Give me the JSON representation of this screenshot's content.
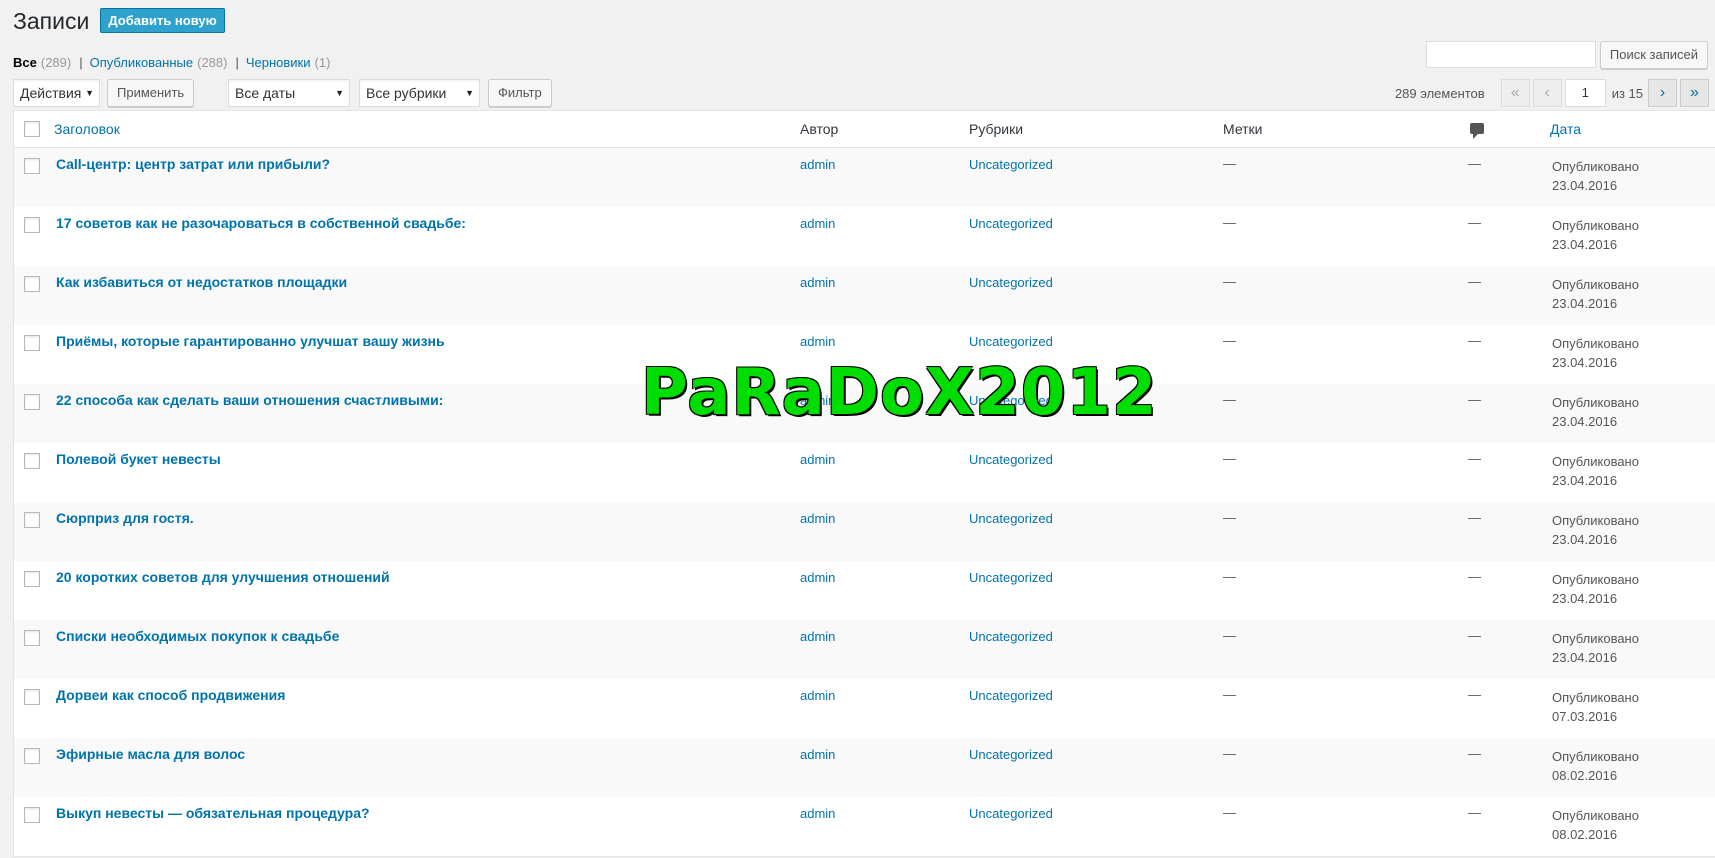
{
  "header": {
    "title": "Записи",
    "add_new": "Добавить новую"
  },
  "filters": {
    "all_label": "Все",
    "all_count": "(289)",
    "published_label": "Опубликованные",
    "published_count": "(288)",
    "drafts_label": "Черновики",
    "drafts_count": "(1)",
    "separator": "|"
  },
  "search": {
    "button": "Поиск записей",
    "value": ""
  },
  "toolbar": {
    "bulk_actions": "Действия",
    "apply": "Применить",
    "dates": "Все даты",
    "categories": "Все рубрики",
    "filter": "Фильтр"
  },
  "pagination": {
    "total": "289 элементов",
    "first": "«",
    "prev": "‹",
    "current": "1",
    "of": "из 15",
    "next": "›",
    "last": "»"
  },
  "table": {
    "columns": {
      "title": "Заголовок",
      "author": "Автор",
      "categories": "Рубрики",
      "tags": "Метки",
      "comments_icon": "comment-icon",
      "date": "Дата"
    },
    "rows": [
      {
        "title": "Call-центр: центр затрат или прибыли?",
        "author": "admin",
        "category": "Uncategorized",
        "tags": "—",
        "comments": "—",
        "status": "Опубликовано",
        "date": "23.04.2016"
      },
      {
        "title": "17 советов как не разочароваться в собственной свадьбе:",
        "author": "admin",
        "category": "Uncategorized",
        "tags": "—",
        "comments": "—",
        "status": "Опубликовано",
        "date": "23.04.2016"
      },
      {
        "title": "Как избавиться от недостатков площадки",
        "author": "admin",
        "category": "Uncategorized",
        "tags": "—",
        "comments": "—",
        "status": "Опубликовано",
        "date": "23.04.2016"
      },
      {
        "title": "Приёмы, которые гарантированно улучшат вашу жизнь",
        "author": "admin",
        "category": "Uncategorized",
        "tags": "—",
        "comments": "—",
        "status": "Опубликовано",
        "date": "23.04.2016"
      },
      {
        "title": "22 способа как сделать ваши отношения счастливыми:",
        "author": "admin",
        "category": "Uncategorized",
        "tags": "—",
        "comments": "—",
        "status": "Опубликовано",
        "date": "23.04.2016"
      },
      {
        "title": "Полевой букет невесты",
        "author": "admin",
        "category": "Uncategorized",
        "tags": "—",
        "comments": "—",
        "status": "Опубликовано",
        "date": "23.04.2016"
      },
      {
        "title": "Сюрприз для гостя.",
        "author": "admin",
        "category": "Uncategorized",
        "tags": "—",
        "comments": "—",
        "status": "Опубликовано",
        "date": "23.04.2016"
      },
      {
        "title": "20 коротких советов для улучшения отношений",
        "author": "admin",
        "category": "Uncategorized",
        "tags": "—",
        "comments": "—",
        "status": "Опубликовано",
        "date": "23.04.2016"
      },
      {
        "title": "Списки необходимых покупок к свадьбе",
        "author": "admin",
        "category": "Uncategorized",
        "tags": "—",
        "comments": "—",
        "status": "Опубликовано",
        "date": "23.04.2016"
      },
      {
        "title": "Дорвеи как способ продвижения",
        "author": "admin",
        "category": "Uncategorized",
        "tags": "—",
        "comments": "—",
        "status": "Опубликовано",
        "date": "07.03.2016"
      },
      {
        "title": "Эфирные масла для волос",
        "author": "admin",
        "category": "Uncategorized",
        "tags": "—",
        "comments": "—",
        "status": "Опубликовано",
        "date": "08.02.2016"
      },
      {
        "title": "Выкуп невесты — обязательная процедура?",
        "author": "admin",
        "category": "Uncategorized",
        "tags": "—",
        "comments": "—",
        "status": "Опубликовано",
        "date": "08.02.2016"
      }
    ]
  },
  "watermark": "PaRaDoX2012",
  "colors": {
    "link": "#0073aa",
    "add_new_bg": "#2ea2cc",
    "watermark": "#00dd00",
    "page_bg": "#f1f1f1"
  }
}
